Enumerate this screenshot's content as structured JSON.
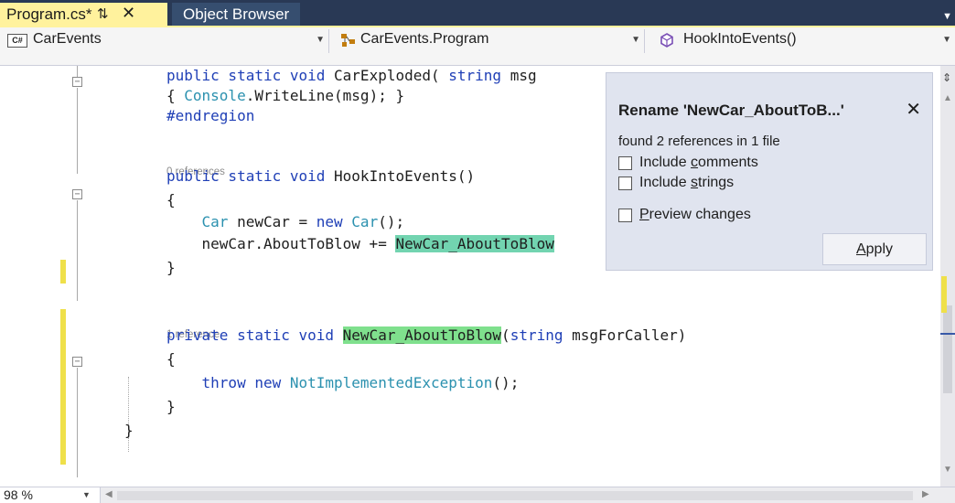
{
  "tabs": [
    {
      "label": "Program.cs*",
      "pin_icon": "pin-icon",
      "close_icon": "close-icon",
      "active": true
    },
    {
      "label": "Object Browser",
      "active": false
    }
  ],
  "nav": {
    "project": "CarEvents",
    "project_icon_text": "C#",
    "type": "CarEvents.Program",
    "member": "HookIntoEvents()"
  },
  "code": {
    "lines": [
      {
        "kind": "code",
        "segments": [
          [
            "kw",
            "public static void "
          ],
          [
            "",
            "CarExploded( "
          ],
          [
            "kw",
            "string"
          ],
          [
            "",
            " msg"
          ]
        ]
      },
      {
        "kind": "code",
        "segments": [
          [
            "",
            "{ "
          ],
          [
            "ty",
            "Console"
          ],
          [
            "",
            ".WriteLine(msg); }"
          ]
        ]
      },
      {
        "kind": "code",
        "segments": [
          [
            "kw",
            "#endregion"
          ]
        ]
      },
      {
        "kind": "blank"
      },
      {
        "kind": "lens",
        "text": "0 references"
      },
      {
        "kind": "code",
        "segments": [
          [
            "kw",
            "public static void "
          ],
          [
            "",
            "HookIntoEvents()"
          ]
        ]
      },
      {
        "kind": "code",
        "segments": [
          [
            "",
            "{"
          ]
        ]
      },
      {
        "kind": "code",
        "segments": [
          [
            "",
            "    "
          ],
          [
            "ty",
            "Car"
          ],
          [
            "",
            " newCar = "
          ],
          [
            "kw",
            "new "
          ],
          [
            "ty",
            "Car"
          ],
          [
            "",
            "();"
          ]
        ]
      },
      {
        "kind": "code",
        "segments": [
          [
            "",
            "    newCar.AboutToBlow += "
          ],
          [
            "hl-edit",
            "NewCar_AboutToBlow"
          ]
        ]
      },
      {
        "kind": "code",
        "segments": [
          [
            "",
            "}"
          ]
        ]
      },
      {
        "kind": "blank"
      },
      {
        "kind": "lens",
        "text": "1 reference"
      },
      {
        "kind": "code",
        "segments": [
          [
            "kw",
            "private static void "
          ],
          [
            "hl",
            "NewCar_AboutToBlow"
          ],
          [
            "",
            "("
          ],
          [
            "kw",
            "string"
          ],
          [
            "",
            " msgForCaller)"
          ]
        ]
      },
      {
        "kind": "code",
        "segments": [
          [
            "",
            "{"
          ]
        ]
      },
      {
        "kind": "code",
        "segments": [
          [
            "",
            "    "
          ],
          [
            "kw",
            "throw new "
          ],
          [
            "ty",
            "NotImplementedException"
          ],
          [
            "",
            "();"
          ]
        ]
      },
      {
        "kind": "code",
        "segments": [
          [
            "",
            "}"
          ]
        ]
      },
      {
        "kind": "code",
        "segments": [
          [
            "",
            "}"
          ]
        ],
        "outdent": true
      }
    ]
  },
  "rename_dialog": {
    "title": "Rename 'NewCar_AboutToB...'",
    "close_icon": "close-icon",
    "found": "found 2 references in 1 file",
    "options": [
      {
        "prefix": "Include ",
        "access": "c",
        "rest": "omments",
        "checked": false
      },
      {
        "prefix": "Include ",
        "access": "s",
        "rest": "trings",
        "checked": false
      },
      {
        "prefix": "",
        "access": "P",
        "rest": "review changes",
        "checked": false
      }
    ],
    "apply_access": "A",
    "apply_rest": "pply"
  },
  "status": {
    "zoom": "98 %"
  },
  "colors": {
    "tab_active": "#fff29d",
    "tab_strip": "#293955",
    "keyword": "#1f3fb6",
    "type": "#2b91af",
    "highlight": "#7fe08d",
    "dialog_bg": "#e0e4ef"
  }
}
